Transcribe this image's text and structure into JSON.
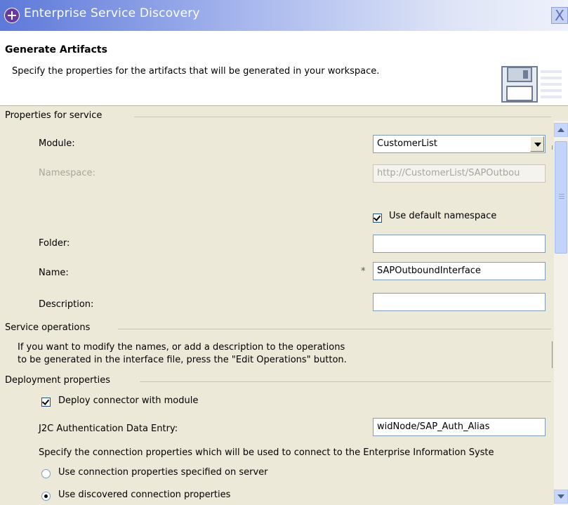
{
  "window": {
    "title": "Enterprise Service Discovery",
    "close_glyph": "X"
  },
  "header": {
    "title": "Generate Artifacts",
    "description": "Specify the properties for the artifacts that will be generated in your workspace.",
    "icon": "save-disk-icon"
  },
  "properties_group": {
    "label": "Properties for service",
    "module_label": "Module:",
    "module_value": "CustomerList",
    "namespace_label": "Namespace:",
    "namespace_value": "http://CustomerList/SAPOutbou",
    "use_default_namespace_label": "Use default namespace",
    "use_default_namespace_checked": true,
    "folder_label": "Folder:",
    "folder_value": "",
    "name_label": "Name:",
    "name_required": "*",
    "name_value": "SAPOutboundInterface",
    "description_label": "Description:",
    "description_value": ""
  },
  "operations_group": {
    "label": "Service operations",
    "text_line1": "If you want to modify the names, or add a description to the operations",
    "text_line2": "to be generated in the interface file, press the \"Edit Operations\" button."
  },
  "deployment_group": {
    "label": "Deployment properties",
    "deploy_connector_label": "Deploy connector with module",
    "deploy_connector_checked": true,
    "j2c_label": "J2C Authentication Data Entry:",
    "j2c_value": "widNode/SAP_Auth_Alias",
    "connection_text": "Specify the connection properties which will be used to connect to the Enterprise Information Syste",
    "radio_server_label": "Use connection properties specified on server",
    "radio_discovered_label": "Use discovered connection properties",
    "selected": "discovered"
  },
  "colors": {
    "titlebar_start": "#5d79d9",
    "panel_bg": "#ece9d8",
    "header_bg": "#ffffff"
  }
}
